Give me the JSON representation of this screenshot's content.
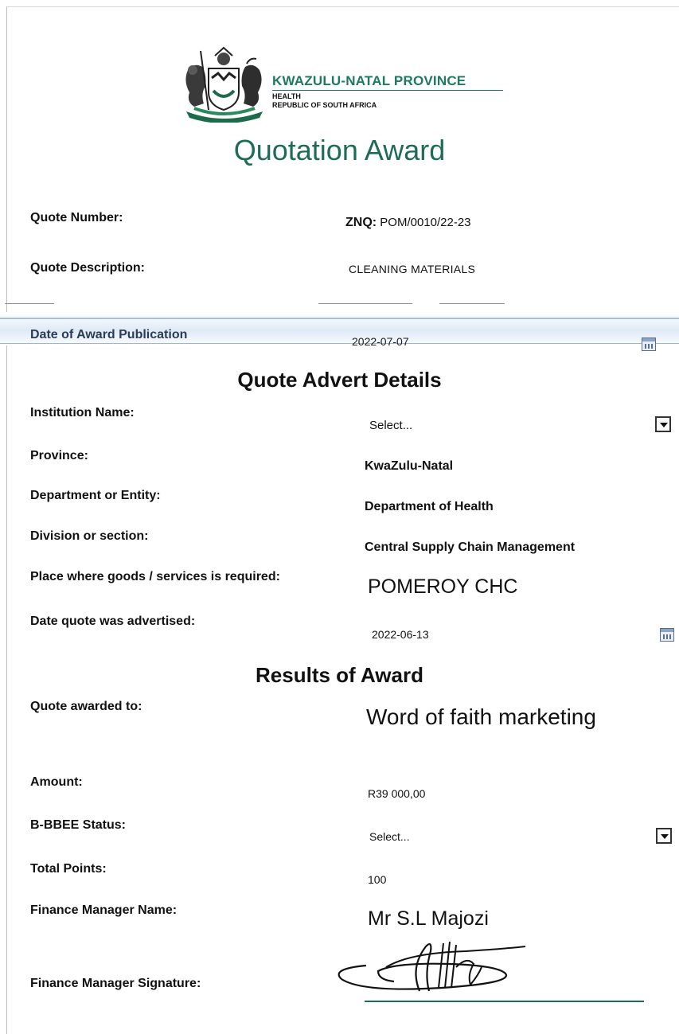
{
  "header": {
    "province_name": "KWAZULU-NATAL PROVINCE",
    "department": "HEALTH",
    "country": "REPUBLIC OF SOUTH AFRICA",
    "title": "Quotation Award"
  },
  "quote": {
    "number_label": "Quote Number:",
    "number_prefix": "ZNQ:",
    "number_value": "POM/0010/22-23",
    "description_label": "Quote Description:",
    "description_value": "CLEANING MATERIALS",
    "publication_label": "Date of Award Publication",
    "publication_value": "2022-07-07"
  },
  "advert": {
    "heading": "Quote Advert Details",
    "institution_label": "Institution Name:",
    "institution_value": "Select...",
    "province_label": "Province:",
    "province_value": "KwaZulu-Natal",
    "department_label": "Department or Entity:",
    "department_value": "Department of Health",
    "division_label": "Division or section:",
    "division_value": "Central Supply Chain Management",
    "place_label": "Place where goods /  services is required:",
    "place_value": "POMEROY CHC",
    "advertised_label": "Date quote was advertised:",
    "advertised_value": "2022-06-13"
  },
  "results": {
    "heading": "Results of Award",
    "awarded_label": "Quote awarded to:",
    "awarded_value": "Word of faith marketing",
    "amount_label": "Amount:",
    "amount_value": "R39 000,00",
    "bbbee_label": "B-BBEE Status:",
    "bbbee_value": "Select...",
    "points_label": "Total Points:",
    "points_value": "100",
    "manager_name_label": "Finance Manager Name:",
    "manager_name_value": "Mr S.L Majozi",
    "manager_signature_label": "Finance Manager Signature:"
  }
}
